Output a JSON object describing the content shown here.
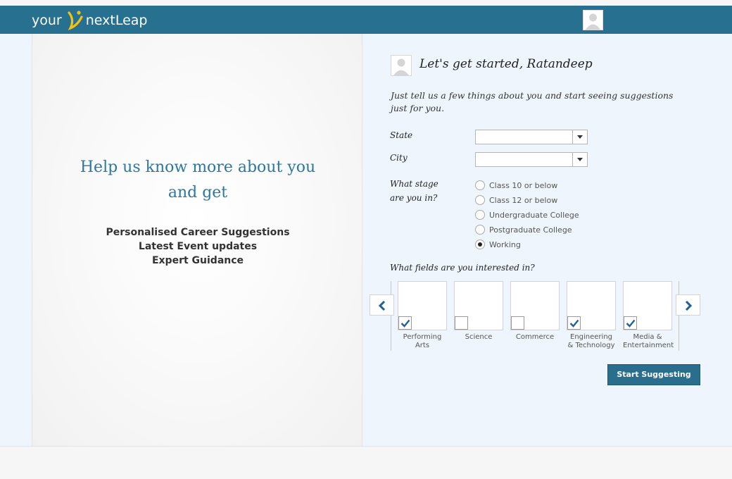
{
  "header": {
    "logo_left": "your",
    "logo_right": "nextLeap"
  },
  "left": {
    "headline_line1": "Help us know more about you",
    "headline_line2": "and get",
    "benefits": [
      "Personalised Career Suggestions",
      "Latest Event updates",
      "Expert Guidance"
    ]
  },
  "form": {
    "title": "Let's get started, Ratandeep",
    "intro": "Just tell us a few things about you and start seeing suggestions just for you.",
    "state_label": "State",
    "state_value": "",
    "city_label": "City",
    "city_value": "",
    "stage_label_line1": "What stage",
    "stage_label_line2": "are you in?",
    "stage_options": [
      {
        "label": "Class 10 or below",
        "selected": false
      },
      {
        "label": "Class 12 or below",
        "selected": false
      },
      {
        "label": "Undergraduate College",
        "selected": false
      },
      {
        "label": "Postgraduate College",
        "selected": false
      },
      {
        "label": "Working",
        "selected": true
      }
    ],
    "fields_label": "What fields are you interested in?",
    "fields": [
      {
        "line1": "Performing",
        "line2": "Arts",
        "checked": true
      },
      {
        "line1": "Science",
        "line2": "",
        "checked": false
      },
      {
        "line1": "Commerce",
        "line2": "",
        "checked": false
      },
      {
        "line1": "Engineering",
        "line2": "& Technology",
        "checked": true
      },
      {
        "line1": "Media &",
        "line2": "Entertainment",
        "checked": true
      }
    ],
    "submit_label": "Start Suggesting"
  },
  "colors": {
    "brand": "#27708f",
    "accent_text": "#2a78a0",
    "check": "#1f5f9e"
  },
  "icons": [
    "logo-figure-icon",
    "user-avatar-icon",
    "chevron-down-icon",
    "chevron-left-icon",
    "chevron-right-icon",
    "checkmark-icon"
  ]
}
